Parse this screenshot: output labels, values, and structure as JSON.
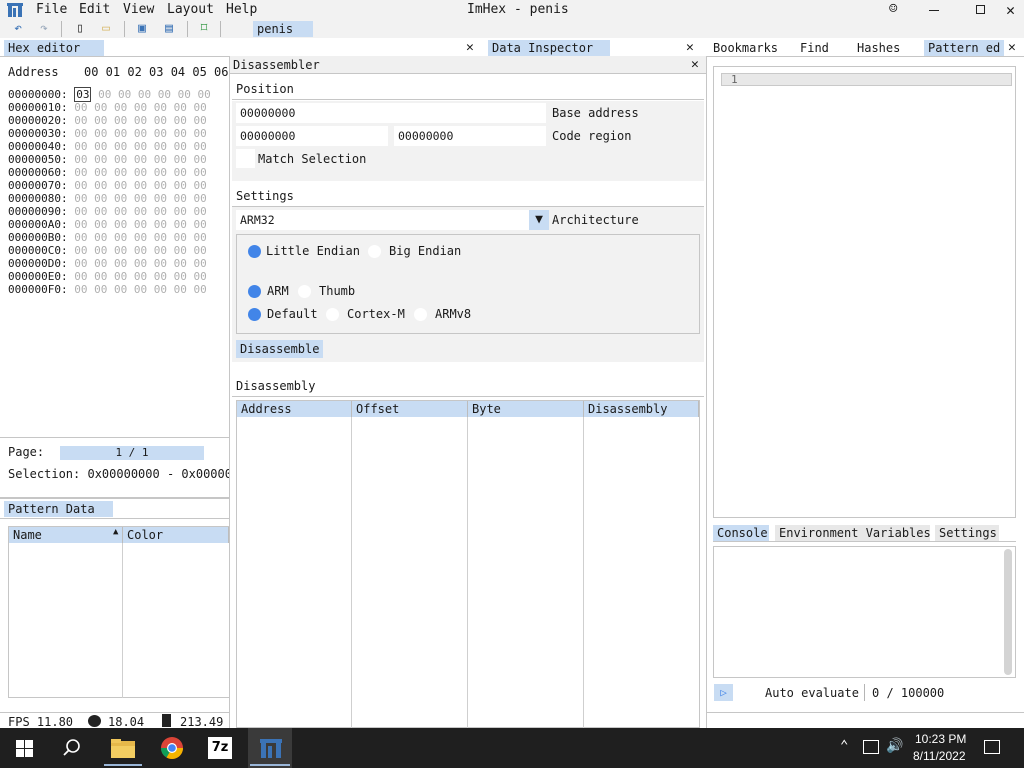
{
  "window": {
    "title": "ImHex - penis"
  },
  "menu": {
    "file": "File",
    "edit": "Edit",
    "view": "View",
    "layout": "Layout",
    "help": "Help"
  },
  "toolbar": {
    "file_tab": "penis"
  },
  "hex_editor": {
    "tab": "Hex editor",
    "address_label": "Address",
    "columns": "00 01 02 03 04 05 06",
    "first_byte": "03",
    "rows": [
      {
        "addr": "00000000:",
        "bytes": "   00 00 00 00 00 00"
      },
      {
        "addr": "00000010:",
        "bytes": "00 00 00 00 00 00 00"
      },
      {
        "addr": "00000020:",
        "bytes": "00 00 00 00 00 00 00"
      },
      {
        "addr": "00000030:",
        "bytes": "00 00 00 00 00 00 00"
      },
      {
        "addr": "00000040:",
        "bytes": "00 00 00 00 00 00 00"
      },
      {
        "addr": "00000050:",
        "bytes": "00 00 00 00 00 00 00"
      },
      {
        "addr": "00000060:",
        "bytes": "00 00 00 00 00 00 00"
      },
      {
        "addr": "00000070:",
        "bytes": "00 00 00 00 00 00 00"
      },
      {
        "addr": "00000080:",
        "bytes": "00 00 00 00 00 00 00"
      },
      {
        "addr": "00000090:",
        "bytes": "00 00 00 00 00 00 00"
      },
      {
        "addr": "000000A0:",
        "bytes": "00 00 00 00 00 00 00"
      },
      {
        "addr": "000000B0:",
        "bytes": "00 00 00 00 00 00 00"
      },
      {
        "addr": "000000C0:",
        "bytes": "00 00 00 00 00 00 00"
      },
      {
        "addr": "000000D0:",
        "bytes": "00 00 00 00 00 00 00"
      },
      {
        "addr": "000000E0:",
        "bytes": "00 00 00 00 00 00 00"
      },
      {
        "addr": "000000F0:",
        "bytes": "00 00 00 00 00 00 00"
      }
    ],
    "page_label": "Page:",
    "page_value": "1 / 1",
    "selection_label": "Selection: 0x00000000 - 0x000000"
  },
  "pattern_data": {
    "tab": "Pattern Data",
    "col_name": "Name",
    "col_color": "Color"
  },
  "data_inspector": {
    "tab": "Data Inspector"
  },
  "disassembler": {
    "title": "Disassembler",
    "position_header": "Position",
    "base_address_value": "00000000",
    "base_address_label": "Base address",
    "code_region_start": "00000000",
    "code_region_end": "00000000",
    "code_region_label": "Code region",
    "match_selection_label": "Match Selection",
    "settings_header": "Settings",
    "architecture_value": "ARM32",
    "architecture_label": "Architecture",
    "little_endian": "Little Endian",
    "big_endian": "Big Endian",
    "arm": "ARM",
    "thumb": "Thumb",
    "default": "Default",
    "cortex_m": "Cortex-M",
    "armv8": "ARMv8",
    "disassemble_button": "Disassemble",
    "disassembly_header": "Disassembly",
    "columns": [
      "Address",
      "Offset",
      "Byte",
      "Disassembly"
    ]
  },
  "right_panel": {
    "tabs": [
      "Bookmarks",
      "Find",
      "Hashes",
      "Pattern ed"
    ],
    "line_number": "1",
    "console_tabs": [
      "Console",
      "Environment Variables",
      "Settings"
    ],
    "auto_evaluate": "Auto evaluate",
    "counter": "0 / 100000"
  },
  "status": {
    "fps": "FPS 11.80",
    "value2": "18.04",
    "value3": "213.49"
  },
  "taskbar": {
    "time": "10:23 PM",
    "date": "8/11/2022",
    "sevenzip_label": "7z"
  },
  "colors": {
    "accent": "#c8dcf3",
    "radio_on": "#4285e8",
    "taskbar": "#1f1f1f"
  }
}
